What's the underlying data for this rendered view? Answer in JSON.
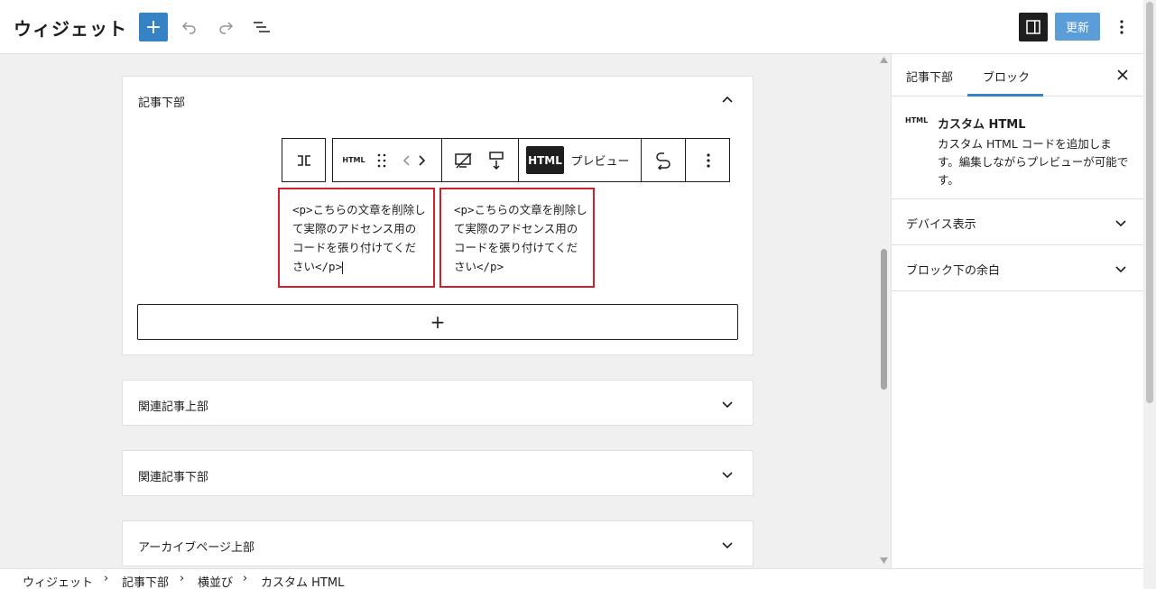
{
  "header": {
    "title": "ウィジェット",
    "add_label": "+",
    "update_label": "更新"
  },
  "widget_areas": [
    {
      "title": "記事下部",
      "expanded": true
    },
    {
      "title": "関連記事上部",
      "expanded": false
    },
    {
      "title": "関連記事下部",
      "expanded": false
    },
    {
      "title": "アーカイブページ上部",
      "expanded": false
    }
  ],
  "toolbar": {
    "html_badge": "HTML",
    "html_tab": "HTML",
    "preview_tab": "プレビュー"
  },
  "html_blocks": [
    {
      "content": "<p>こちらの文章を削除して実際のアドセンス用のコードを張り付けてください</p>"
    },
    {
      "content": "<p>こちらの文章を削除して実際のアドセンス用のコードを張り付けてください</p>"
    }
  ],
  "appender_label": "+",
  "sidebar": {
    "tabs": [
      "記事下部",
      "ブロック"
    ],
    "active_tab": "ブロック",
    "block_icon_label": "HTML",
    "block_title": "カスタム HTML",
    "block_description": "カスタム HTML コードを追加します。編集しながらプレビューが可能です。",
    "panels": [
      "デバイス表示",
      "ブロック下の余白"
    ]
  },
  "breadcrumb": [
    "ウィジェット",
    "記事下部",
    "横並び",
    "カスタム HTML"
  ],
  "colors": {
    "accent": "#3582c4",
    "selection_border": "#d0202e",
    "canvas_bg": "#f0f0f0"
  }
}
